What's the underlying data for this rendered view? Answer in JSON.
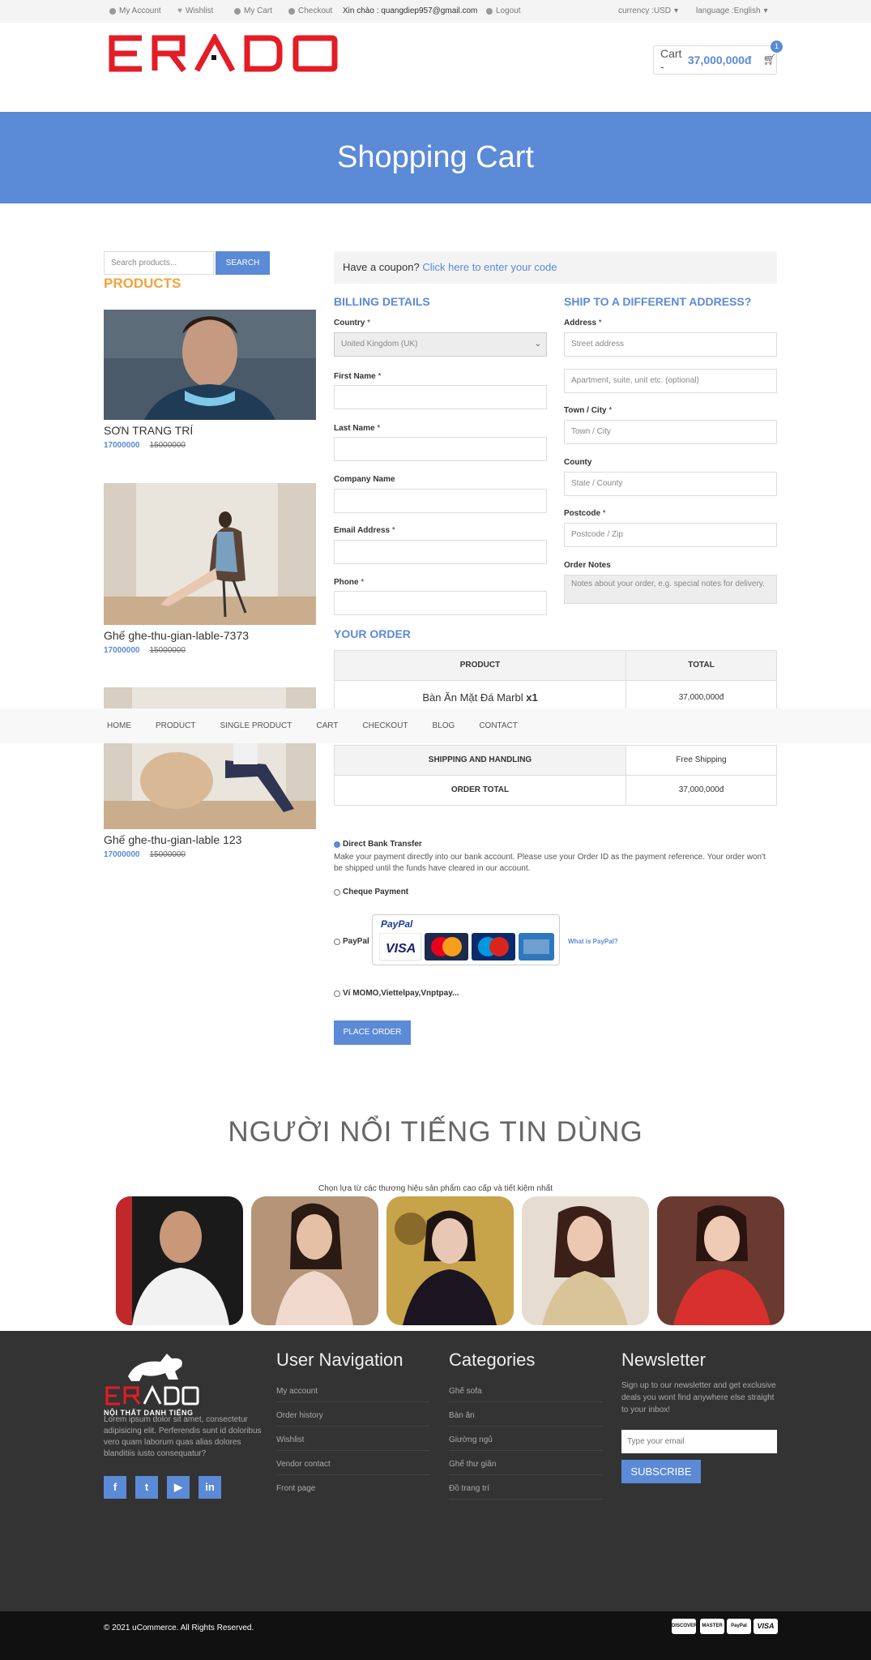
{
  "topbar": {
    "account": "My Account",
    "wishlist": "Wishlist",
    "cart": "My Cart",
    "checkout": "Checkout",
    "greeting": "Xin chào : quangdiep957@gmail.com",
    "logout": "Logout",
    "currency": "currency :USD",
    "language": "language :English"
  },
  "brand": {
    "logo": "ERADO",
    "tagline": "NỘI THẤT DANH TIẾNG"
  },
  "cart": {
    "label": "Cart - ",
    "amount": "37,000,000đ",
    "count": "1"
  },
  "banner": {
    "title": "Shopping Cart"
  },
  "search": {
    "placeholder": "Search products...",
    "button": "SEARCH"
  },
  "sidebar": {
    "heading": "PRODUCTS",
    "products": [
      {
        "name": "SƠN TRANG TRÍ",
        "price": "17000000",
        "old": "15000000"
      },
      {
        "name": "Ghế ghe-thu-gian-lable-7373",
        "price": "17000000",
        "old": "15000000"
      },
      {
        "name": "Ghế ghe-thu-gian-lable 123",
        "price": "17000000",
        "old": "15000000"
      }
    ]
  },
  "coupon": {
    "text": "Have a coupon?",
    "link": "Click here to enter your code"
  },
  "billing": {
    "heading": "BILLING DETAILS",
    "country_label": "Country",
    "country_value": "United Kingdom (UK)",
    "first": "First Name",
    "last": "Last Name",
    "company": "Company Name",
    "email": "Email Address",
    "phone": "Phone",
    "req": "*"
  },
  "shipping": {
    "heading": "SHIP TO A DIFFERENT ADDRESS?",
    "address_label": "Address",
    "address_ph": "Street address",
    "address2_ph": "Apartment, suite, unit etc. (optional)",
    "town_label": "Town / City",
    "town_ph": "Town / City",
    "county_label": "County",
    "county_ph": "State / County",
    "postcode_label": "Postcode",
    "postcode_ph": "Postcode / Zip",
    "notes_label": "Order Notes",
    "notes_ph": "Notes about your order, e.g. special notes for delivery."
  },
  "order": {
    "heading": "YOUR ORDER",
    "col_product": "PRODUCT",
    "col_total": "TOTAL",
    "item": "Bàn Ăn Mặt Đá Marbl",
    "qty": "x1",
    "item_total": "37,000,000đ",
    "shipping_label": "SHIPPING AND HANDLING",
    "shipping_value": "Free Shipping",
    "total_label": "ORDER TOTAL",
    "total_value": "37,000,000đ"
  },
  "nav": [
    "HOME",
    "PRODUCT",
    "SINGLE PRODUCT",
    "CART",
    "CHECKOUT",
    "BLOG",
    "CONTACT"
  ],
  "payment": {
    "bank": "Direct Bank Transfer",
    "bank_desc": "Make your payment directly into our bank account. Please use your Order ID as the payment reference. Your order won't be shipped until the funds have cleared in our account.",
    "cheque": "Cheque Payment",
    "paypal": "PayPal",
    "paypal_logo": "PayPal",
    "what": "What is PayPal?",
    "momo": "Ví MOMO,Viettelpay,Vnptpay...",
    "place": "PLACE ORDER"
  },
  "famous": {
    "title": "NGƯỜI NỔI TIẾNG TIN DÙNG",
    "subtitle": "Chọn lựa từ các thương hiệu sản phẩm cao cấp và tiết kiệm nhất"
  },
  "footer": {
    "desc": "Lorem ipsum dolor sit amet, consectetur adipisicing elit. Perferendis sunt id doloribus vero quam laborum quas alias dolores blanditiis iusto consequatur?",
    "nav_heading": "User Navigation",
    "nav": [
      "My account",
      "Order history",
      "Wishlist",
      "Vendor contact",
      "Front page"
    ],
    "cat_heading": "Categories",
    "cats": [
      "Ghế sofa",
      "Bàn ăn",
      "Giường ngủ",
      "Ghế thư giãn",
      "Đồ trang trí"
    ],
    "nl_heading": "Newsletter",
    "nl_sub": "Sign up to our newsletter and get exclusive deals you wont find anywhere else straight to your inbox!",
    "nl_ph": "Type your email",
    "nl_btn": "SUBSCRIBE",
    "social": [
      "f",
      "t",
      "yt",
      "in"
    ],
    "copyright": "© 2021 uCommerce. All Rights Reserved.",
    "cards": [
      "DISCOVER",
      "MASTER",
      "PayPal",
      "VISA"
    ]
  },
  "colors": {
    "accent": "#5b8ad6",
    "orange": "#f3a33a",
    "logo_red": "#e31d25"
  }
}
